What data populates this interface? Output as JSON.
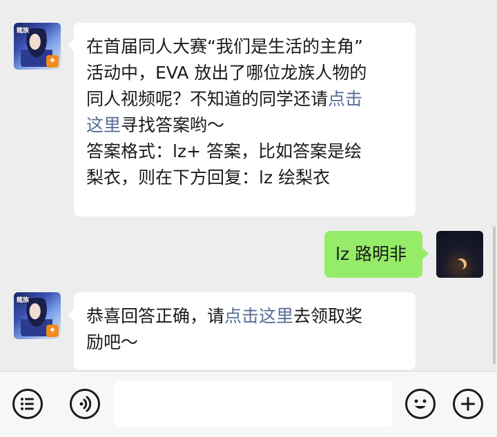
{
  "messages": [
    {
      "sender": "other",
      "avatar": "game-avatar",
      "lines": [
        [
          {
            "t": "在首届同人大赛“我们是生活的主角”"
          }
        ],
        [
          {
            "t": "活动中，EVA 放出了哪位龙族人物的"
          }
        ],
        [
          {
            "t": "同人视频呢？不知道的同学还请"
          },
          {
            "t": "点击",
            "link": true
          }
        ],
        [
          {
            "t": "这里",
            "link": true
          },
          {
            "t": "寻找答案哟～"
          }
        ],
        [
          {
            "t": "答案格式：lz+ 答案，比如答案是绘"
          }
        ],
        [
          {
            "t": "梨衣，则在下方回复：lz 绘梨衣"
          }
        ]
      ]
    },
    {
      "sender": "me",
      "avatar": "night-moon-avatar",
      "lines": [
        [
          {
            "t": "lz 路明非"
          }
        ]
      ]
    },
    {
      "sender": "other",
      "avatar": "game-avatar",
      "lines": [
        [
          {
            "t": "恭喜回答正确，请"
          },
          {
            "t": "点击这里",
            "link": true
          },
          {
            "t": "去领取奖"
          }
        ],
        [
          {
            "t": "励吧～"
          }
        ]
      ]
    }
  ],
  "input": {
    "value": ""
  },
  "icons": {
    "menu": "list-menu-icon",
    "voice": "voice-icon",
    "emoji": "emoji-icon",
    "more": "add-icon"
  },
  "colors": {
    "background": "#ededed",
    "my_bubble": "#95ec69",
    "other_bubble": "#ffffff",
    "link": "#576b95"
  }
}
